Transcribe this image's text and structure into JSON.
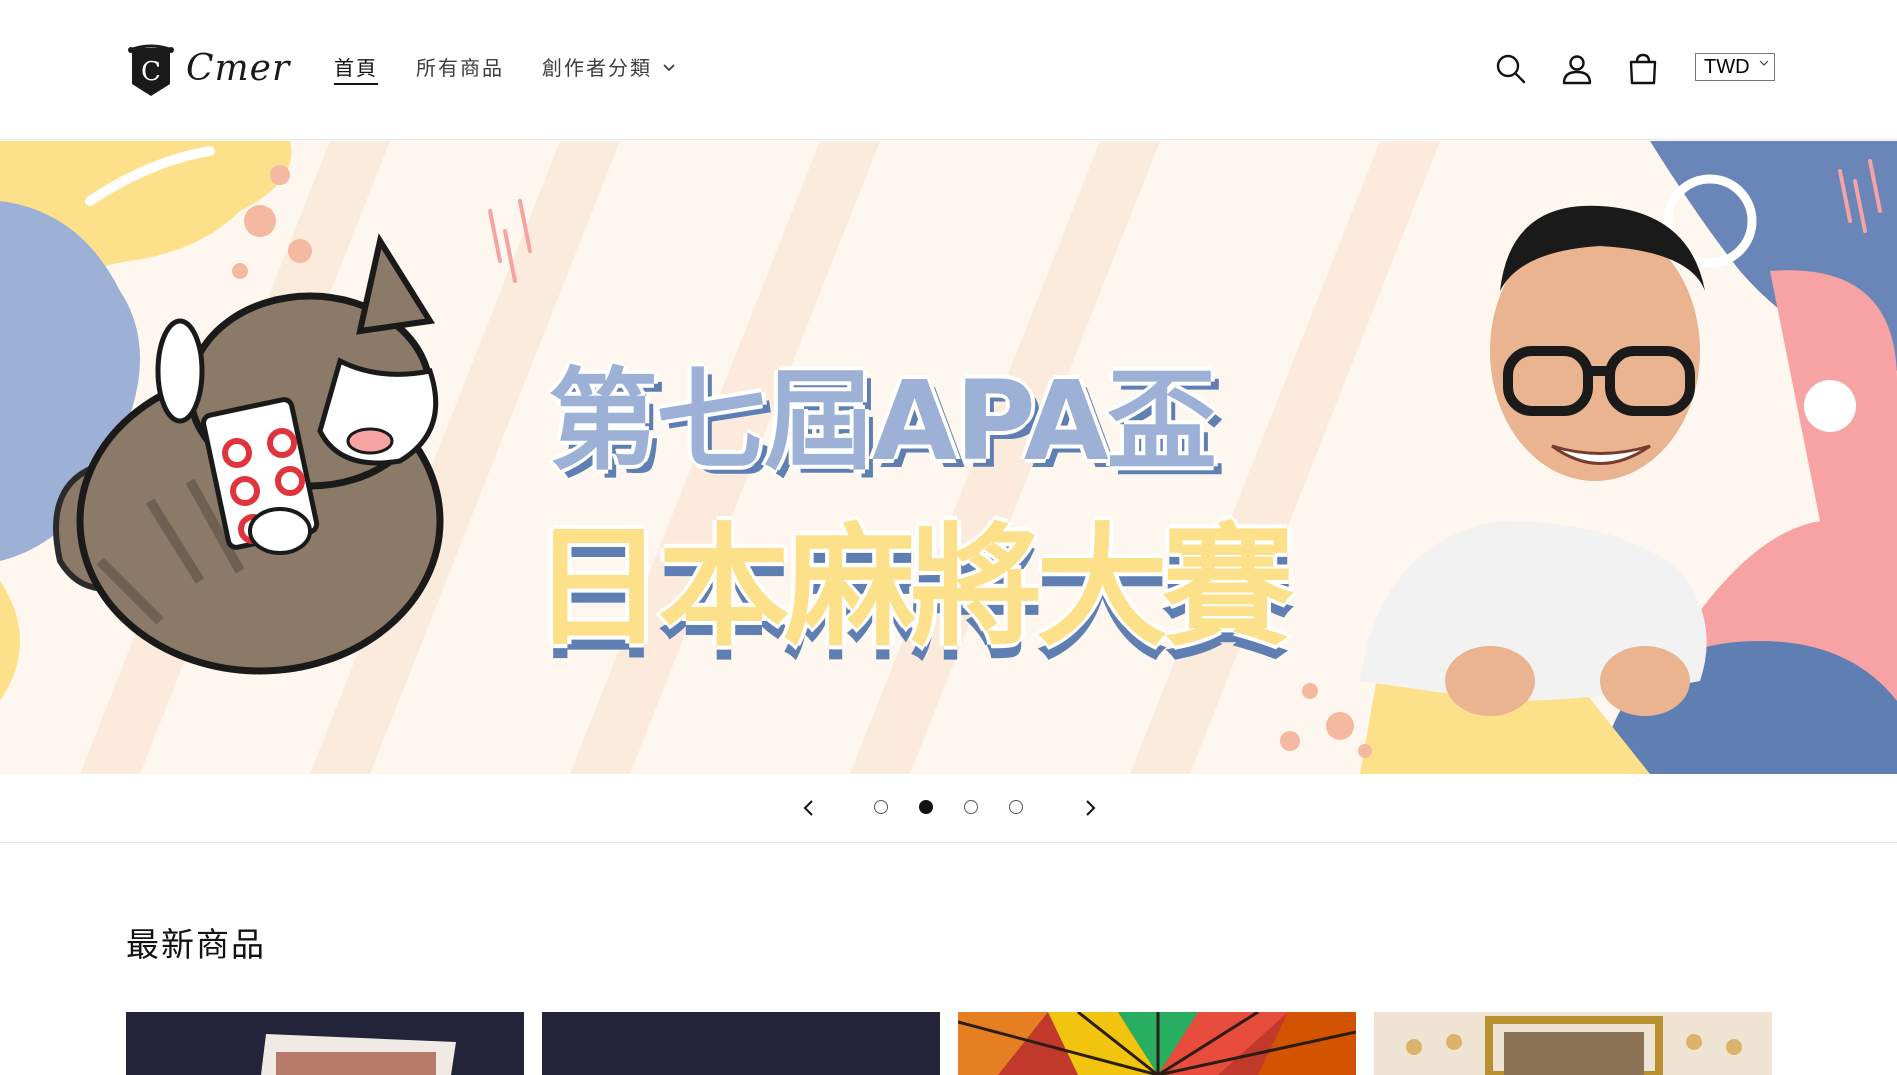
{
  "header": {
    "logo_text": "Cmer",
    "logo_letter": "C",
    "nav": [
      {
        "label": "首頁",
        "active": true
      },
      {
        "label": "所有商品",
        "active": false
      },
      {
        "label": "創作者分類",
        "active": false,
        "dropdown": true
      }
    ],
    "icons": [
      "search-icon",
      "account-icon",
      "cart-icon"
    ],
    "currency": {
      "selected": "TWD"
    }
  },
  "announcement_progress": 0.2,
  "hero": {
    "slides": [
      {
        "title_line1": "第七屆APA盃",
        "title_line2": "日本麻將大賽"
      }
    ],
    "slide_count": 4,
    "active_slide": 2
  },
  "new_products": {
    "title": "最新商品"
  },
  "colors": {
    "accent": "#1ab8b8",
    "hero_blue": "#9db1d6",
    "hero_dark_blue": "#5f7fb3",
    "hero_yellow": "#fde08a",
    "hero_pink": "#f7a3a3"
  }
}
